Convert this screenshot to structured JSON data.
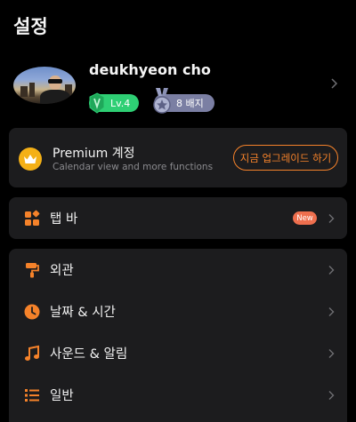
{
  "header": {
    "title": "설정"
  },
  "profile": {
    "name": "deukhyeon cho",
    "level_label": "Lv.4",
    "badge_label": "8 배지",
    "level_color": "#2ecf74",
    "badge_color": "#7b7fa3"
  },
  "premium": {
    "title": "Premium 계정",
    "subtitle": "Calendar view and more functions",
    "button_label": "지금 업그레이드 하기",
    "accent": "#f5822a",
    "crown_color": "#f4b016"
  },
  "tab_bar_item": {
    "label": "탭 바",
    "badge": "New",
    "icon": "grid-icon"
  },
  "settings": {
    "items": [
      {
        "label": "외관",
        "icon": "paint-roller-icon"
      },
      {
        "label": "날짜 & 시간",
        "icon": "clock-icon"
      },
      {
        "label": "사운드 & 알림",
        "icon": "music-note-icon"
      },
      {
        "label": "일반",
        "icon": "list-icon"
      }
    ]
  },
  "colors": {
    "background": "#000000",
    "card": "#1c1c1e",
    "icon_orange": "#f5822a",
    "new_badge": "#ee6f4e"
  }
}
